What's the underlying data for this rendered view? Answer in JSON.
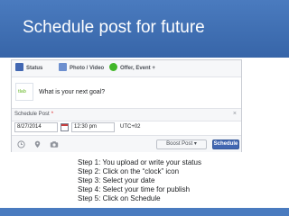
{
  "slide": {
    "title": "Schedule post for future"
  },
  "colors": {
    "title_band": "#4a7bbf",
    "facebook_blue": "#4267b2"
  },
  "composer": {
    "tabs": [
      {
        "label": "Status",
        "icon": "status-icon"
      },
      {
        "label": "Photo / Video",
        "icon": "photo-icon"
      },
      {
        "label": "Offer, Event +",
        "icon": "offer-icon"
      }
    ],
    "avatar_text": "tlab",
    "prompt": "What is your next goal?",
    "schedule_label": "Schedule Post",
    "schedule_required": "*",
    "close": "×",
    "date_value": "8/27/2014",
    "time_value": "12:30 pm",
    "timezone": "UTC+02",
    "action_icons": [
      "clock-icon",
      "location-icon",
      "camera-icon"
    ],
    "boost_label": "Boost Post ▾",
    "schedule_button": "Schedule"
  },
  "steps": [
    "Step 1: You upload or write your status",
    "Step 2: Click on the “clock” icon",
    "Step 3: Select your date",
    "Step 4: Select your time for publish",
    "Step 5: Click on Schedule"
  ]
}
